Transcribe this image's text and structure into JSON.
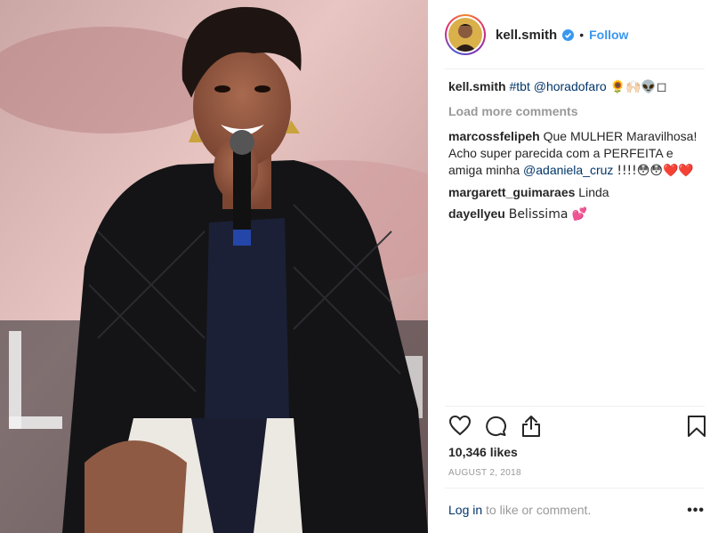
{
  "post": {
    "username": "kell.smith",
    "follow_label": "Follow",
    "separator": "•"
  },
  "caption": {
    "username": "kell.smith",
    "hashtag": "#tbt",
    "mention": "@horadofaro",
    "emojis": "🌻🙌🏻👽◻"
  },
  "load_more": "Load more comments",
  "comments": [
    {
      "username": "marcossfelipeh",
      "text_before": "Que MULHER Maravilhosa! Acho super parecida com a PERFEITA e amiga minha",
      "mention": "@adaniela_cruz",
      "text_after": "!!!!😳😳❤️❤️"
    },
    {
      "username": "margarett_guimaraes",
      "text": "Linda"
    },
    {
      "username": "dayellyeu",
      "text": "Belissima 💕"
    }
  ],
  "likes": "10,346 likes",
  "date": "AUGUST 2, 2018",
  "footer": {
    "login": "Log in",
    "rest": "to like or comment.",
    "more": "•••"
  },
  "icons": {
    "like": "heart-icon",
    "comment": "comment-icon",
    "share": "share-icon",
    "save": "bookmark-icon",
    "verified": "verified-badge-icon"
  },
  "colors": {
    "follow": "#3897f0",
    "link": "#003569",
    "muted": "#999999",
    "text": "#262626"
  }
}
